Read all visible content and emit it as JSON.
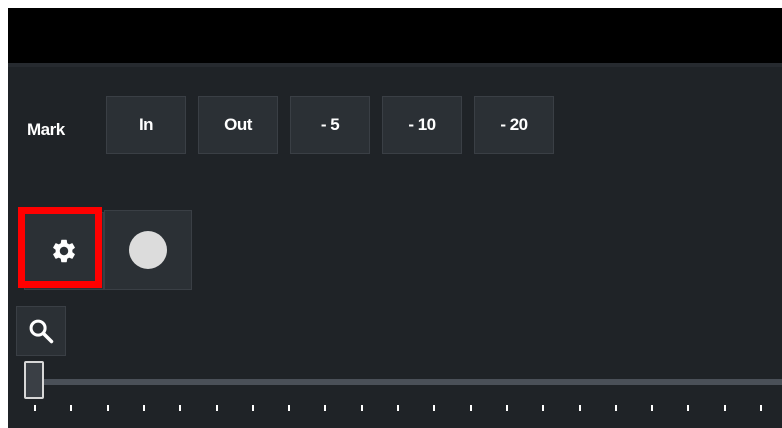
{
  "toolbar": {
    "mark_label": "Mark",
    "buttons": [
      "In",
      "Out",
      "- 5",
      "- 10",
      "- 20"
    ]
  },
  "controls": {
    "settings_icon": "gear-icon",
    "record_icon": "record-dot-icon",
    "zoom_icon": "search-icon",
    "highlight_color": "#ff0000"
  },
  "timeline": {
    "slider_position": 0.0,
    "tick_count": 21
  }
}
